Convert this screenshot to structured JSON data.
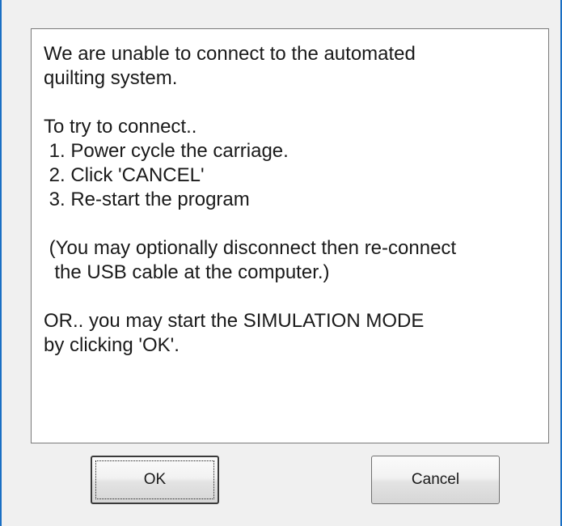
{
  "dialog": {
    "message": "We are unable to connect to the automated\nquilting system.\n\nTo try to connect..\n 1. Power cycle the carriage.\n 2. Click 'CANCEL'\n 3. Re-start the program\n\n (You may optionally disconnect then re-connect\n  the USB cable at the computer.)\n\nOR.. you may start the SIMULATION MODE\nby clicking 'OK'.",
    "ok_label": "OK",
    "cancel_label": "Cancel"
  },
  "colors": {
    "window_border": "#1a6fc4",
    "dialog_background": "#f0f0f0",
    "message_background": "#ffffff"
  }
}
